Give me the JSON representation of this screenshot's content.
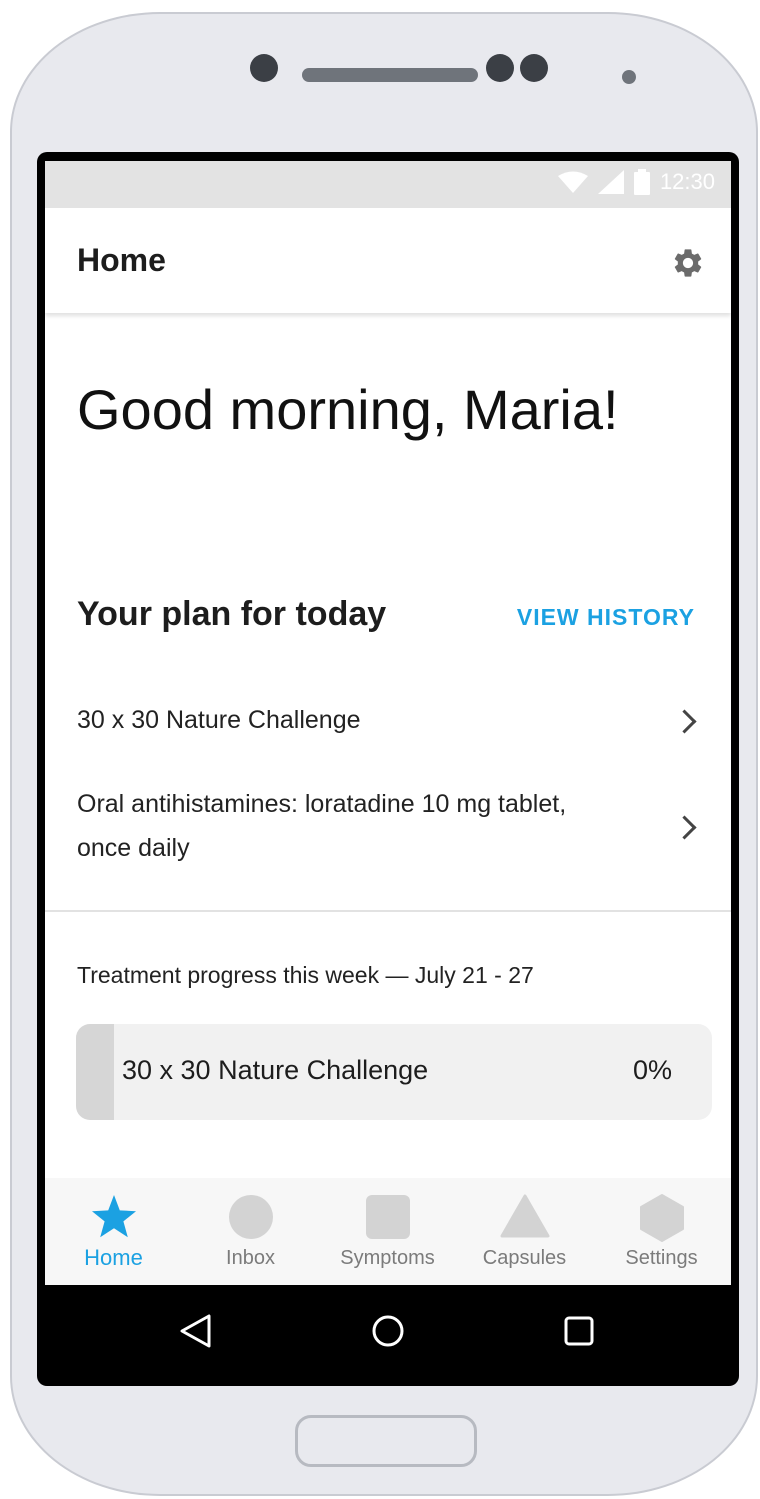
{
  "status_bar": {
    "time": "12:30"
  },
  "app_bar": {
    "title": "Home",
    "settings_icon": "gear-icon"
  },
  "greeting": "Good morning, Maria!",
  "plan": {
    "title": "Your plan for today",
    "view_history_label": "VIEW HISTORY",
    "items": [
      {
        "label": "30 x 30 Nature Challenge"
      },
      {
        "label": "Oral antihistamines: loratadine 10 mg tablet, once daily"
      }
    ]
  },
  "progress": {
    "title": "Treatment progress this week — July 21 - 27",
    "items": [
      {
        "label": "30 x 30 Nature Challenge",
        "percent_label": "0%",
        "percent": 0
      }
    ]
  },
  "bottom_nav": {
    "items": [
      {
        "label": "Home",
        "icon": "star-icon",
        "active": true
      },
      {
        "label": "Inbox",
        "icon": "circle-icon",
        "active": false
      },
      {
        "label": "Symptoms",
        "icon": "square-icon",
        "active": false
      },
      {
        "label": "Capsules",
        "icon": "triangle-icon",
        "active": false
      },
      {
        "label": "Settings",
        "icon": "hexagon-icon",
        "active": false
      }
    ]
  },
  "colors": {
    "accent": "#1ba1e2",
    "nav_inactive": "#d3d3d3",
    "progress_track": "#f1f1f1",
    "progress_fill": "#d6d6d6"
  }
}
